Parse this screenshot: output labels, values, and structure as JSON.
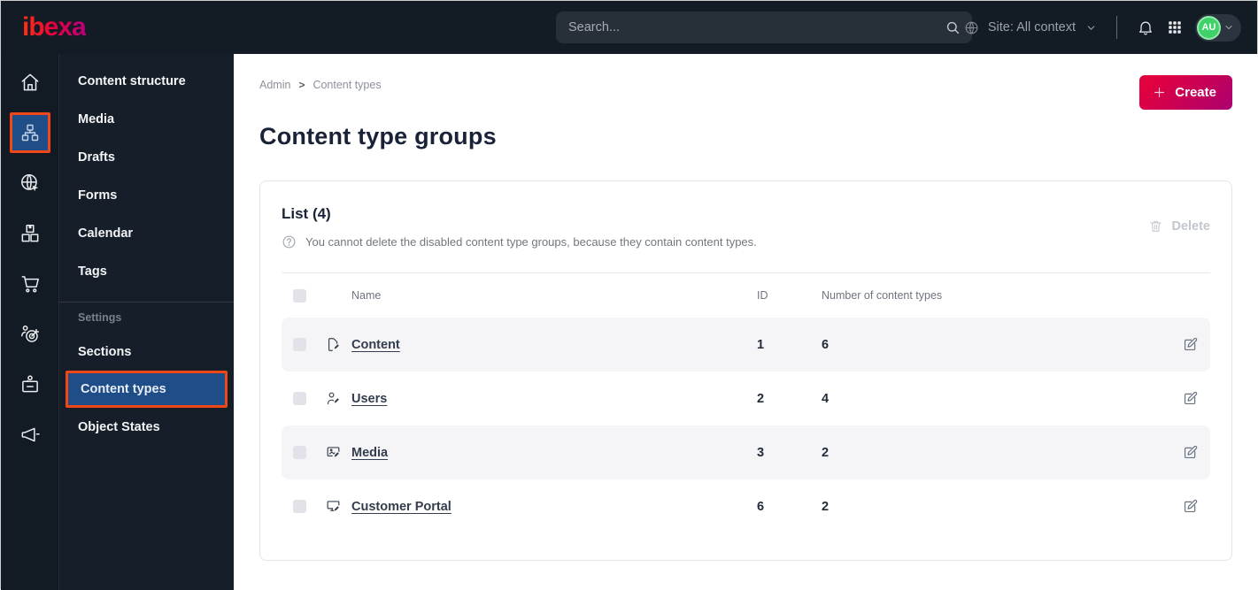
{
  "topbar": {
    "logo_text": "ibexa",
    "search": {
      "placeholder": "Search..."
    },
    "site_context_label": "Site: All context",
    "avatar_initials": "AU",
    "icons": [
      "search-icon",
      "globe-icon",
      "chevron-down-icon",
      "bell-icon",
      "app-grid-icon",
      "avatar"
    ]
  },
  "icon_rail": {
    "icons": [
      "home-icon",
      "content-structure-icon",
      "site-globe-pointer-icon",
      "products-boxes-icon",
      "cart-icon",
      "personalization-target-icon",
      "admin-badge-icon",
      "campaign-megaphone-icon"
    ],
    "active_icon": "content-structure-icon"
  },
  "sidebar": {
    "items": [
      {
        "label": "Content structure"
      },
      {
        "label": "Media"
      },
      {
        "label": "Drafts"
      },
      {
        "label": "Forms"
      },
      {
        "label": "Calendar"
      },
      {
        "label": "Tags"
      }
    ],
    "settings": {
      "section_label": "Settings",
      "items": [
        {
          "label": "Sections",
          "active": false
        },
        {
          "label": "Content types",
          "active": true
        },
        {
          "label": "Object States",
          "active": false
        }
      ]
    }
  },
  "main": {
    "breadcrumb": {
      "items": [
        "Admin",
        "Content types"
      ],
      "separator": ">"
    },
    "create_button_label": "Create",
    "page_title": "Content type groups",
    "list_card": {
      "title": "List (4)",
      "help_text": "You cannot delete the disabled content type groups, because they contain content types.",
      "delete_button_label": "Delete",
      "table": {
        "columns": {
          "name": "Name",
          "id": "ID",
          "count": "Number of content types"
        },
        "rows": [
          {
            "icon": "content-file-icon",
            "name": "Content",
            "id": "1",
            "count": "6"
          },
          {
            "icon": "users-person-icon",
            "name": "Users",
            "id": "2",
            "count": "4"
          },
          {
            "icon": "media-image-icon",
            "name": "Media",
            "id": "3",
            "count": "2"
          },
          {
            "icon": "portal-monitor-icon",
            "name": "Customer Portal",
            "id": "6",
            "count": "2"
          }
        ]
      }
    }
  },
  "colors": {
    "topbar_bg": "#131b24",
    "sidebar_bg": "#161e29",
    "active_item_blue": "#1f4d87",
    "annotation_orange": "#f04718",
    "accent_gradient_start": "#e2013f",
    "accent_gradient_end": "#ae016d",
    "avatar_green": "#3ed268",
    "row_stripe": "#f5f5f8",
    "card_border": "#e3e5ec"
  }
}
